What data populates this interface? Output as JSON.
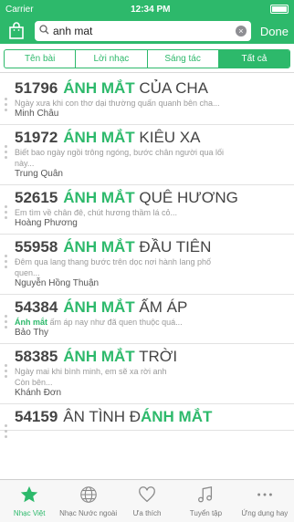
{
  "status": {
    "carrier": "Carrier",
    "time": "12:34 PM"
  },
  "header": {
    "search_value": "anh mat",
    "done_label": "Done"
  },
  "segments": [
    {
      "label": "Tên bài",
      "active": false
    },
    {
      "label": "Lời nhạc",
      "active": false
    },
    {
      "label": "Sáng tác",
      "active": false
    },
    {
      "label": "Tất cả",
      "active": true
    }
  ],
  "songs": [
    {
      "id": "51796",
      "title_hl": "ÁNH MẮT",
      "title_rest": " CỦA CHA",
      "lyric_line1": "Ngày xưa khi con thơ dại thường quấn quanh bên cha...",
      "lyric_line2": "",
      "author": "Minh Châu"
    },
    {
      "id": "51972",
      "title_hl": "ÁNH MẮT",
      "title_rest": " KIÊU XA",
      "lyric_line1": "Biết bao ngày ngồi trông ngóng, bước chân người qua lối",
      "lyric_line2": "này...",
      "author": "Trung Quân"
    },
    {
      "id": "52615",
      "title_hl": "ÁNH MẮT",
      "title_rest": " QUÊ HƯƠNG",
      "lyric_line1": "Em tìm về chân đê, chút hương thầm lá cỏ...",
      "lyric_line2": "",
      "author": "Hoàng Phương"
    },
    {
      "id": "55958",
      "title_hl": "ÁNH MẮT",
      "title_rest": " ĐẦU TIÊN",
      "lyric_line1": "Đêm qua lang thang bước trên dọc nơi hành lang phố",
      "lyric_line2": "quen...",
      "author": "Nguyễn Hồng Thuận"
    },
    {
      "id": "54384",
      "title_hl": "ÁNH MẮT",
      "title_rest": " ẤM ÁP",
      "lyric_hl": "Ánh mắt",
      "lyric_line1": " ấm áp nay như đã quen thuộc quá...",
      "lyric_line2": "",
      "author": "Bảo Thy"
    },
    {
      "id": "58385",
      "title_hl": "ÁNH MẮT",
      "title_rest": " TRỜI",
      "lyric_line1": "Ngày mai khi bình minh, em sẽ xa rời anh",
      "lyric_line2": "Còn bên...",
      "author": "Khánh Đơn"
    },
    {
      "id": "54159",
      "title_pre": "ÂN TÌNH Đ",
      "title_hl": "ÁNH MẮT",
      "title_rest": "",
      "lyric_line1": "",
      "lyric_line2": "",
      "author": ""
    }
  ],
  "tabs": [
    {
      "label": "Nhạc Việt",
      "icon": "star-icon",
      "active": true
    },
    {
      "label": "Nhạc Nước ngoài",
      "icon": "globe-icon",
      "active": false
    },
    {
      "label": "Ưa thích",
      "icon": "heart-icon",
      "active": false
    },
    {
      "label": "Tuyển tập",
      "icon": "music-note-icon",
      "active": false
    },
    {
      "label": "Ứng dụng hay",
      "icon": "more-icon",
      "active": false
    }
  ],
  "colors": {
    "accent": "#2db96b"
  }
}
